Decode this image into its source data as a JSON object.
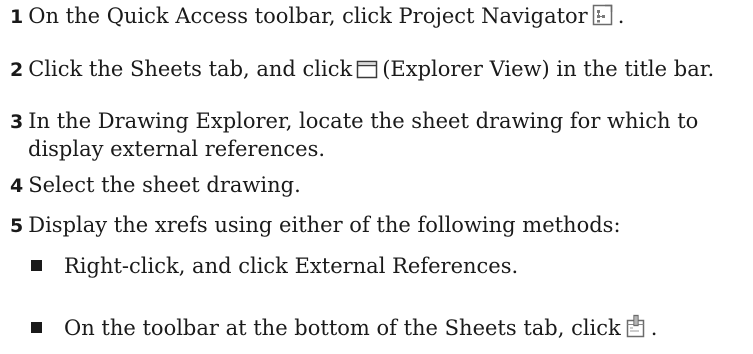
{
  "steps": [
    {
      "num": "1",
      "pre": "On the Quick Access toolbar, click Project Navigator",
      "post": ".",
      "icon": "project-navigator-icon"
    },
    {
      "num": "2",
      "pre": "Click the Sheets tab, and click",
      "post": "(Explorer View) in the title bar.",
      "icon": "explorer-view-icon"
    },
    {
      "num": "3",
      "line1": "In the Drawing Explorer, locate the sheet drawing for which to",
      "line2": "display external references."
    },
    {
      "num": "4",
      "text": "Select the sheet drawing."
    },
    {
      "num": "5",
      "text": "Display the xrefs using either of the following methods:"
    }
  ],
  "bullets": [
    {
      "text": "Right-click, and click External References."
    },
    {
      "pre": "On the toolbar at the bottom of the Sheets tab, click",
      "post": ".",
      "icon": "external-references-icon"
    }
  ]
}
